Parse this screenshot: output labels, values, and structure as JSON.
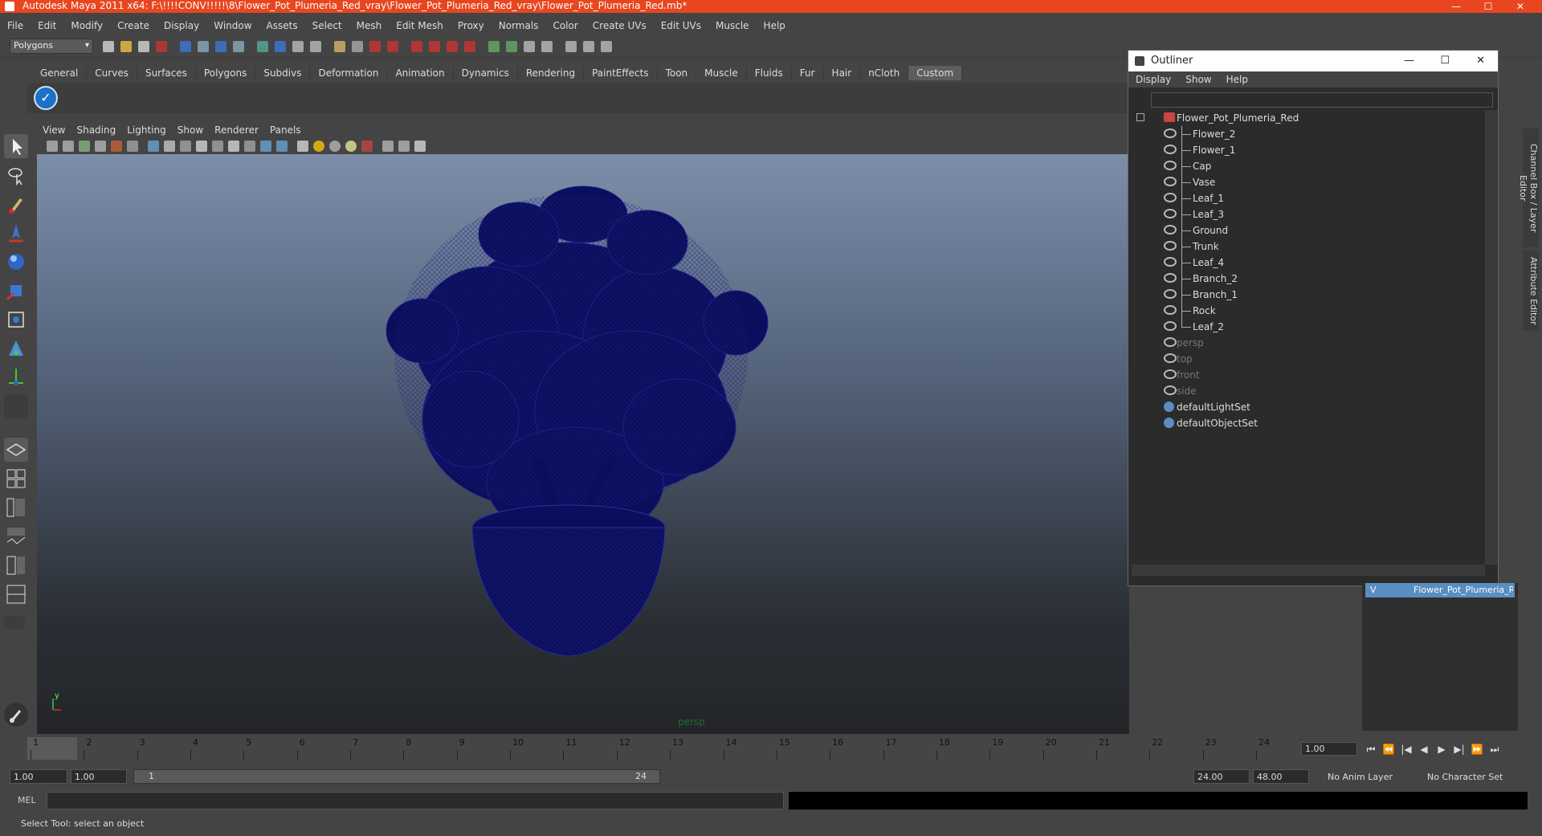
{
  "window": {
    "title": "Autodesk Maya 2011 x64: F:\\!!!!CONV!!!!!\\8\\Flower_Pot_Plumeria_Red_vray\\Flower_Pot_Plumeria_Red_vray\\Flower_Pot_Plumeria_Red.mb*",
    "minimize": "—",
    "maximize": "☐",
    "close": "✕"
  },
  "menubar": [
    "File",
    "Edit",
    "Modify",
    "Create",
    "Display",
    "Window",
    "Assets",
    "Select",
    "Mesh",
    "Edit Mesh",
    "Proxy",
    "Normals",
    "Color",
    "Create UVs",
    "Edit UVs",
    "Muscle",
    "Help"
  ],
  "statusline": {
    "mode": "Polygons"
  },
  "shelf": {
    "tabs": [
      "General",
      "Curves",
      "Surfaces",
      "Polygons",
      "Subdivs",
      "Deformation",
      "Animation",
      "Dynamics",
      "Rendering",
      "PaintEffects",
      "Toon",
      "Muscle",
      "Fluids",
      "Fur",
      "Hair",
      "nCloth",
      "Custom"
    ],
    "active_tab": "Custom"
  },
  "panel_menu": [
    "View",
    "Shading",
    "Lighting",
    "Show",
    "Renderer",
    "Panels"
  ],
  "viewport": {
    "camera_label": "persp",
    "axis_y": "y"
  },
  "outliner": {
    "title": "Outliner",
    "menu": [
      "Display",
      "Show",
      "Help"
    ],
    "root": "Flower_Pot_Plumeria_Red",
    "children": [
      "Flower_2",
      "Flower_1",
      "Cap",
      "Vase",
      "Leaf_1",
      "Leaf_3",
      "Ground",
      "Trunk",
      "Leaf_4",
      "Branch_2",
      "Branch_1",
      "Rock",
      "Leaf_2"
    ],
    "cameras": [
      "persp",
      "top",
      "front",
      "side"
    ],
    "sets": [
      "defaultLightSet",
      "defaultObjectSet"
    ]
  },
  "right_tabs": {
    "channel_box": "Channel Box / Layer Editor",
    "attribute_editor": "Attribute Editor"
  },
  "layer": {
    "name": "Flower_Pot_Plumeria_Red",
    "visibility": "V"
  },
  "timeline": {
    "frames": [
      "1",
      "2",
      "3",
      "4",
      "5",
      "6",
      "7",
      "8",
      "9",
      "10",
      "11",
      "12",
      "13",
      "14",
      "15",
      "16",
      "17",
      "18",
      "19",
      "20",
      "21",
      "22",
      "23",
      "24"
    ],
    "current_time": "1.00",
    "playback_controls": [
      "⏮",
      "⏪",
      "|◀",
      "◀",
      "▶",
      "▶|",
      "⏩",
      "⏭"
    ]
  },
  "range": {
    "start": "1.00",
    "playback_start": "1.00",
    "slider_start": "1",
    "slider_end": "24",
    "playback_end": "24.00",
    "end": "48.00",
    "anim_layer": "No Anim Layer",
    "character_set": "No Character Set"
  },
  "commandline": {
    "label": "MEL"
  },
  "helpline": {
    "text": "Select Tool: select an object"
  },
  "colors": {
    "titlebar": "#e8461f",
    "wireframe": "#0b0e5c",
    "layer_highlight": "#5a8dc0"
  }
}
